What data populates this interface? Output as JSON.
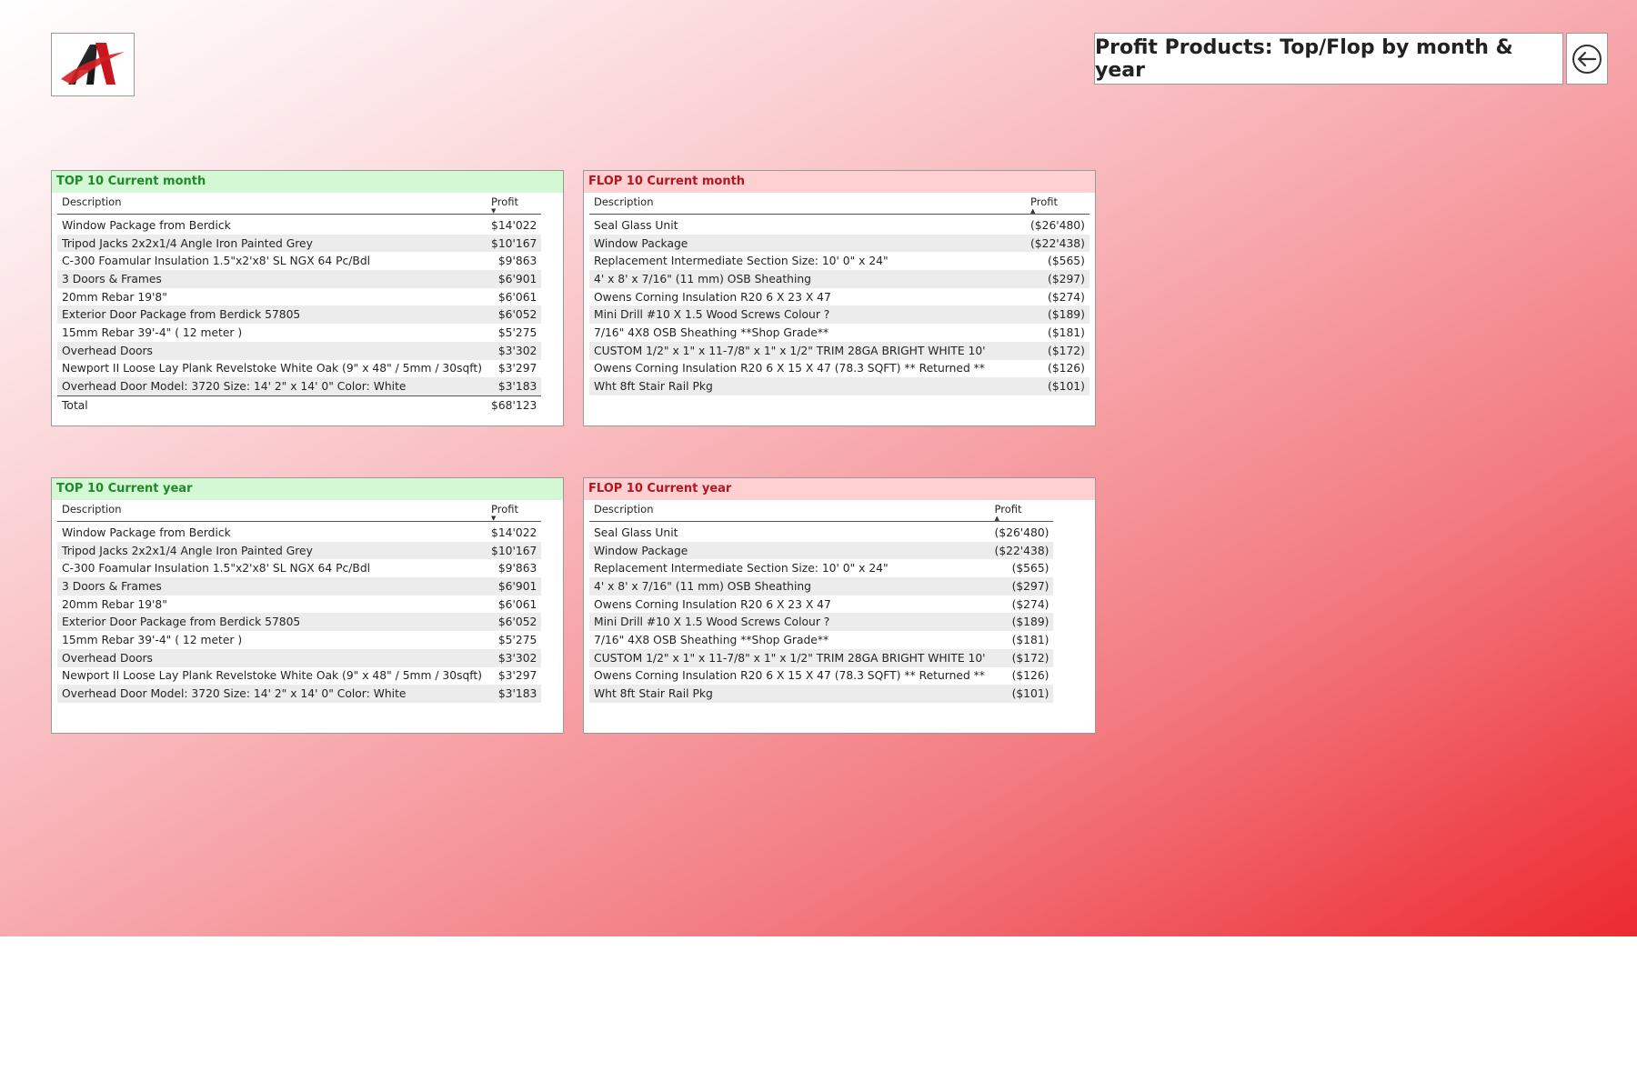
{
  "header": {
    "title": "Profit Products: Top/Flop by month & year",
    "back_icon": "circle-arrow-left-icon",
    "logo_icon": "company-logo-icon",
    "colors": {
      "top_header_bg": "#d4f7d4",
      "top_header_text": "#1f8a28",
      "flop_header_bg": "#ffd0d2",
      "flop_header_text": "#b3161c",
      "gradient_end": "#ec2a30"
    }
  },
  "panels": {
    "top_month": {
      "title": "TOP 10 Current month",
      "col_desc": "Description",
      "col_profit": "Profit",
      "rows": [
        {
          "desc": "Window Package from Berdick",
          "profit": "$14'022"
        },
        {
          "desc": "Tripod Jacks 2x2x1/4 Angle Iron Painted Grey",
          "profit": "$10'167"
        },
        {
          "desc": "C-300 Foamular Insulation 1.5\"x2'x8' SL NGX 64 Pc/Bdl",
          "profit": "$9'863"
        },
        {
          "desc": "3 Doors & Frames",
          "profit": "$6'901"
        },
        {
          "desc": "20mm Rebar 19'8\"",
          "profit": "$6'061"
        },
        {
          "desc": "Exterior Door Package from Berdick 57805",
          "profit": "$6'052"
        },
        {
          "desc": "15mm Rebar 39'-4\" ( 12 meter )",
          "profit": "$5'275"
        },
        {
          "desc": "Overhead Doors",
          "profit": "$3'302"
        },
        {
          "desc": "Newport II Loose Lay Plank Revelstoke White Oak (9\" x 48\" / 5mm / 30sqft)",
          "profit": "$3'297"
        },
        {
          "desc": "Overhead Door Model: 3720 Size: 14' 2\" x 14' 0\" Color: White",
          "profit": "$3'183"
        }
      ],
      "total_label": "Total",
      "total_value": "$68'123"
    },
    "flop_month": {
      "title": "FLOP 10 Current month",
      "col_desc": "Description",
      "col_profit": "Profit",
      "rows": [
        {
          "desc": "Seal Glass Unit",
          "profit": "($26'480)"
        },
        {
          "desc": "Window Package",
          "profit": "($22'438)"
        },
        {
          "desc": "Replacement Intermediate Section Size: 10' 0\" x 24\"",
          "profit": "($565)"
        },
        {
          "desc": "4' x 8' x 7/16\" (11 mm) OSB Sheathing",
          "profit": "($297)"
        },
        {
          "desc": "Owens Corning Insulation R20 6 X 23 X 47",
          "profit": "($274)"
        },
        {
          "desc": "Mini Drill #10 X 1.5 Wood Screws Colour ?",
          "profit": "($189)"
        },
        {
          "desc": "7/16\" 4X8 OSB Sheathing **Shop Grade**",
          "profit": "($181)"
        },
        {
          "desc": "CUSTOM 1/2\" x 1\" x 11-7/8\" x 1\" x 1/2\" TRIM 28GA BRIGHT WHITE 10'",
          "profit": "($172)"
        },
        {
          "desc": "Owens Corning Insulation R20 6 X 15 X 47 (78.3 SQFT) ** Returned **",
          "profit": "($126)"
        },
        {
          "desc": "Wht 8ft Stair Rail Pkg",
          "profit": "($101)"
        }
      ]
    },
    "top_year": {
      "title": "TOP 10 Current year",
      "col_desc": "Description",
      "col_profit": "Profit",
      "rows": [
        {
          "desc": "Window Package from Berdick",
          "profit": "$14'022"
        },
        {
          "desc": "Tripod Jacks 2x2x1/4 Angle Iron Painted Grey",
          "profit": "$10'167"
        },
        {
          "desc": "C-300 Foamular Insulation 1.5\"x2'x8' SL NGX 64 Pc/Bdl",
          "profit": "$9'863"
        },
        {
          "desc": "3 Doors & Frames",
          "profit": "$6'901"
        },
        {
          "desc": "20mm Rebar 19'8\"",
          "profit": "$6'061"
        },
        {
          "desc": "Exterior Door Package from Berdick 57805",
          "profit": "$6'052"
        },
        {
          "desc": "15mm Rebar 39'-4\" ( 12 meter )",
          "profit": "$5'275"
        },
        {
          "desc": "Overhead Doors",
          "profit": "$3'302"
        },
        {
          "desc": "Newport II Loose Lay Plank Revelstoke White Oak (9\" x 48\" / 5mm / 30sqft)",
          "profit": "$3'297"
        },
        {
          "desc": "Overhead Door Model: 3720 Size: 14' 2\" x 14' 0\" Color: White",
          "profit": "$3'183"
        }
      ]
    },
    "flop_year": {
      "title": "FLOP 10 Current year",
      "col_desc": "Description",
      "col_profit": "Profit",
      "rows": [
        {
          "desc": "Seal Glass Unit",
          "profit": "($26'480)"
        },
        {
          "desc": "Window Package",
          "profit": "($22'438)"
        },
        {
          "desc": "Replacement Intermediate Section Size: 10' 0\" x 24\"",
          "profit": "($565)"
        },
        {
          "desc": "4' x 8' x 7/16\" (11 mm) OSB Sheathing",
          "profit": "($297)"
        },
        {
          "desc": "Owens Corning Insulation R20 6 X 23 X 47",
          "profit": "($274)"
        },
        {
          "desc": "Mini Drill #10 X 1.5 Wood Screws Colour ?",
          "profit": "($189)"
        },
        {
          "desc": "7/16\" 4X8 OSB Sheathing **Shop Grade**",
          "profit": "($181)"
        },
        {
          "desc": "CUSTOM 1/2\" x 1\" x 11-7/8\" x 1\" x 1/2\" TRIM 28GA BRIGHT WHITE 10'",
          "profit": "($172)"
        },
        {
          "desc": "Owens Corning Insulation R20 6 X 15 X 47 (78.3 SQFT) ** Returned **",
          "profit": "($126)"
        },
        {
          "desc": "Wht 8ft Stair Rail Pkg",
          "profit": "($101)"
        }
      ]
    }
  }
}
